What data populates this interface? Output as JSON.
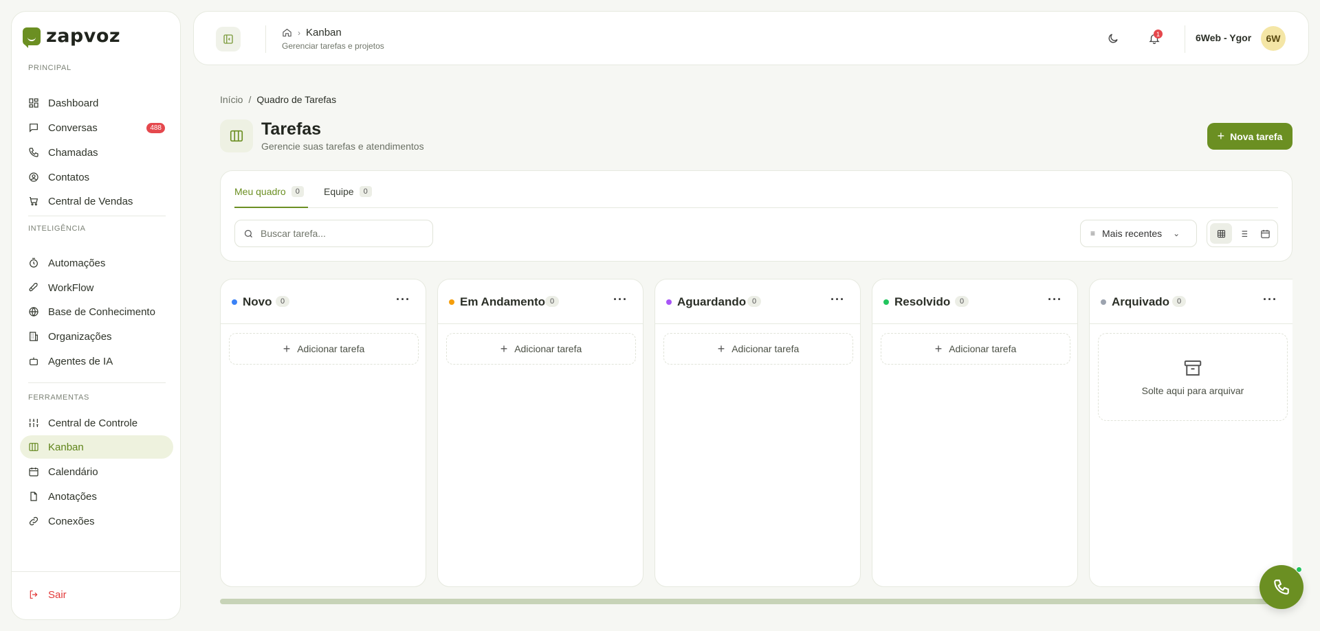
{
  "app": {
    "logo_text": "zapvoz"
  },
  "sidebar": {
    "sections": [
      {
        "title": "PRINCIPAL"
      },
      {
        "title": "INTELIGÊNCIA"
      },
      {
        "title": "FERRAMENTAS"
      }
    ],
    "items": [
      {
        "label": "Dashboard",
        "icon": "dashboard-icon"
      },
      {
        "label": "Conversas",
        "icon": "message-icon",
        "badge": "488"
      },
      {
        "label": "Chamadas",
        "icon": "phone-icon"
      },
      {
        "label": "Contatos",
        "icon": "user-circle-icon"
      },
      {
        "label": "Central de Vendas",
        "icon": "cart-icon"
      },
      {
        "label": "Automações",
        "icon": "timer-icon"
      },
      {
        "label": "WorkFlow",
        "icon": "rocket-icon"
      },
      {
        "label": "Base de Conhecimento",
        "icon": "globe-icon"
      },
      {
        "label": "Organizações",
        "icon": "building-icon"
      },
      {
        "label": "Agentes de IA",
        "icon": "bot-icon"
      },
      {
        "label": "Central de Controle",
        "icon": "sliders-icon"
      },
      {
        "label": "Kanban",
        "icon": "kanban-icon",
        "active": true
      },
      {
        "label": "Calendário",
        "icon": "calendar-icon"
      },
      {
        "label": "Anotações",
        "icon": "file-icon"
      },
      {
        "label": "Conexões",
        "icon": "link-icon"
      }
    ],
    "logout_label": "Sair"
  },
  "topbar": {
    "breadcrumb_title": "Kanban",
    "breadcrumb_sub": "Gerenciar tarefas e projetos",
    "notifications_count": "1",
    "user_name": "6Web - Ygor",
    "avatar_initials": "6W"
  },
  "breadcrumb": {
    "home": "Início",
    "separator": "/",
    "current": "Quadro de Tarefas"
  },
  "page": {
    "title": "Tarefas",
    "subtitle": "Gerencie suas tarefas e atendimentos",
    "new_task_label": "Nova tarefa"
  },
  "tabs": [
    {
      "label": "Meu quadro",
      "count": "0",
      "active": true
    },
    {
      "label": "Equipe",
      "count": "0"
    }
  ],
  "search": {
    "placeholder": "Buscar tarefa..."
  },
  "sort": {
    "label": "Mais recentes"
  },
  "columns": [
    {
      "title": "Novo",
      "count": "0",
      "color": "#3b82f6",
      "add_label": "Adicionar tarefa"
    },
    {
      "title": "Em Andamento",
      "count": "0",
      "color": "#f59e0b",
      "add_label": "Adicionar tarefa"
    },
    {
      "title": "Aguardando",
      "count": "0",
      "color": "#a855f7",
      "add_label": "Adicionar tarefa"
    },
    {
      "title": "Resolvido",
      "count": "0",
      "color": "#22c55e",
      "add_label": "Adicionar tarefa"
    },
    {
      "title": "Arquivado",
      "count": "0",
      "color": "#9ca3af",
      "drop_label": "Solte aqui para arquivar"
    }
  ],
  "colors": {
    "accent": "#6b8f22",
    "danger": "#e5484d"
  }
}
